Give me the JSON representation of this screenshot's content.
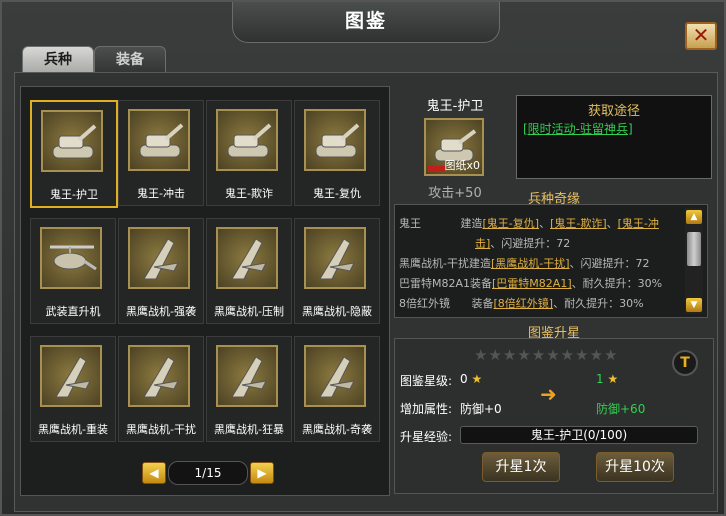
{
  "window": {
    "title": "图鉴",
    "close_label": "✕"
  },
  "tabs": [
    {
      "label": "兵种",
      "active": true
    },
    {
      "label": "装备",
      "active": false
    }
  ],
  "grid": {
    "items": [
      {
        "label": "鬼王-护卫",
        "icon": "tank-icon",
        "selected": true
      },
      {
        "label": "鬼王-冲击",
        "icon": "tank-icon"
      },
      {
        "label": "鬼王-欺诈",
        "icon": "tank-icon"
      },
      {
        "label": "鬼王-复仇",
        "icon": "tank-icon"
      },
      {
        "label": "武装直升机",
        "icon": "helicopter-icon"
      },
      {
        "label": "黑鹰战机-强袭",
        "icon": "jet-icon"
      },
      {
        "label": "黑鹰战机-压制",
        "icon": "jet-icon"
      },
      {
        "label": "黑鹰战机-隐蔽",
        "icon": "jet-icon"
      },
      {
        "label": "黑鹰战机-重装",
        "icon": "jet-icon"
      },
      {
        "label": "黑鹰战机-干扰",
        "icon": "jet-icon"
      },
      {
        "label": "黑鹰战机-狂暴",
        "icon": "jet-icon"
      },
      {
        "label": "黑鹰战机-奇袭",
        "icon": "jet-icon"
      }
    ]
  },
  "pagination": {
    "text": "1/15",
    "prev_label": "◀",
    "next_label": "▶"
  },
  "detail": {
    "name": "鬼王-护卫",
    "blueprint": "图纸x0",
    "attack": "攻击+50"
  },
  "obtain": {
    "title": "获取途径",
    "link": "[限时活动-驻留神兵]"
  },
  "bingzhong": {
    "title": "兵种奇缘",
    "lines": [
      {
        "parts": [
          "鬼王",
          "  建造",
          "[鬼王-复仇]",
          "、",
          "[鬼王-欺诈]",
          "、",
          "[鬼王-冲"
        ]
      },
      {
        "parts": [
          "击]",
          "、闪避提升：72"
        ]
      },
      {
        "parts": [
          "黑鹰战机-干扰建造",
          "[黑鹰战机-干扰]",
          "、闪避提升：72"
        ]
      },
      {
        "parts": [
          "巴雷特M82A1装备",
          "[巴雷特M82A1]",
          "、耐久提升：30%"
        ]
      },
      {
        "parts": [
          "8倍红外镜",
          "  装备",
          "[8倍红外镜]",
          "、耐久提升：30%"
        ]
      }
    ]
  },
  "upgrade": {
    "title": "图鉴升星",
    "stars_total": 10,
    "star_level_label": "图鉴星级:",
    "star_from": "0",
    "star_to": "1",
    "attr_label": "增加属性:",
    "attr_from": "防御+0",
    "attr_to": "防御+60",
    "exp_label": "升星经验:",
    "exp_value": "鬼王-护卫(0/100)",
    "btn1": "升星1次",
    "btn10": "升星10次",
    "colors": {
      "gold": "#f0c030",
      "green": "#30d050"
    }
  }
}
